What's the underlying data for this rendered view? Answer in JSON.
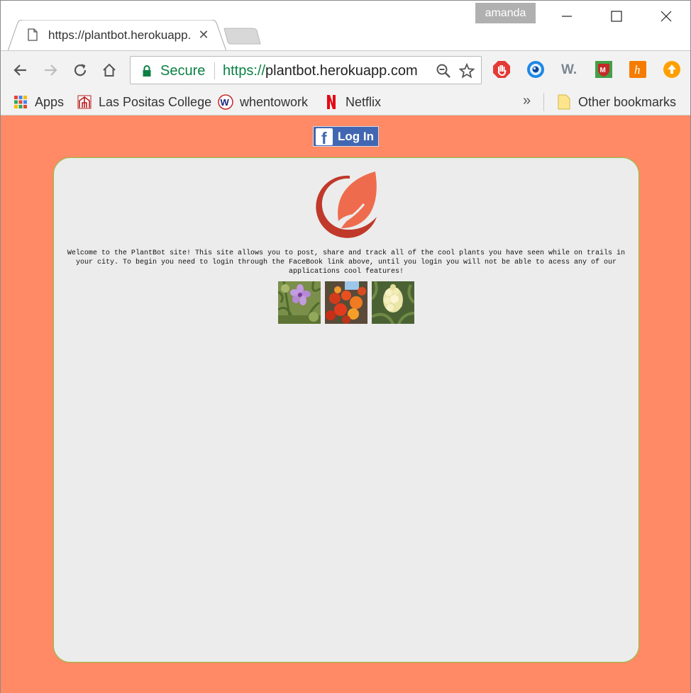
{
  "browser": {
    "profile_name": "amanda",
    "tab": {
      "title": "https://plantbot.herokuapp.com"
    },
    "address_bar": {
      "security_label": "Secure",
      "url_scheme": "https://",
      "url_rest": "plantbot.herokuapp.com"
    },
    "bookmarks": [
      {
        "label": "Apps",
        "icon": "apps-grid-icon"
      },
      {
        "label": "Las Positas College",
        "icon": "las-positas-icon"
      },
      {
        "label": "whentowork",
        "icon": "whentowork-icon"
      },
      {
        "label": "Netflix",
        "icon": "netflix-icon"
      }
    ],
    "overflow_label": "»",
    "other_bookmarks_label": "Other bookmarks",
    "extensions": [
      "adblock-icon",
      "eye-extension-icon",
      "w-extension-icon",
      "mcafee-icon",
      "honey-icon",
      "update-arrow-icon"
    ]
  },
  "page": {
    "background_color": "#ff8a65",
    "card_border_color": "#8bc34a",
    "facebook_login_label": "Log In",
    "welcome_text": "Welcome to the PlantBot site! This site allows you to post, share and track all of the cool plants you have seen while on trails in your city. To begin you need to login through the FaceBook link above, until you login you will not be able to acess any of our applications cool features!",
    "photos": [
      "purple-flower-photo",
      "red-orange-flowers-photo",
      "white-flower-photo"
    ]
  }
}
